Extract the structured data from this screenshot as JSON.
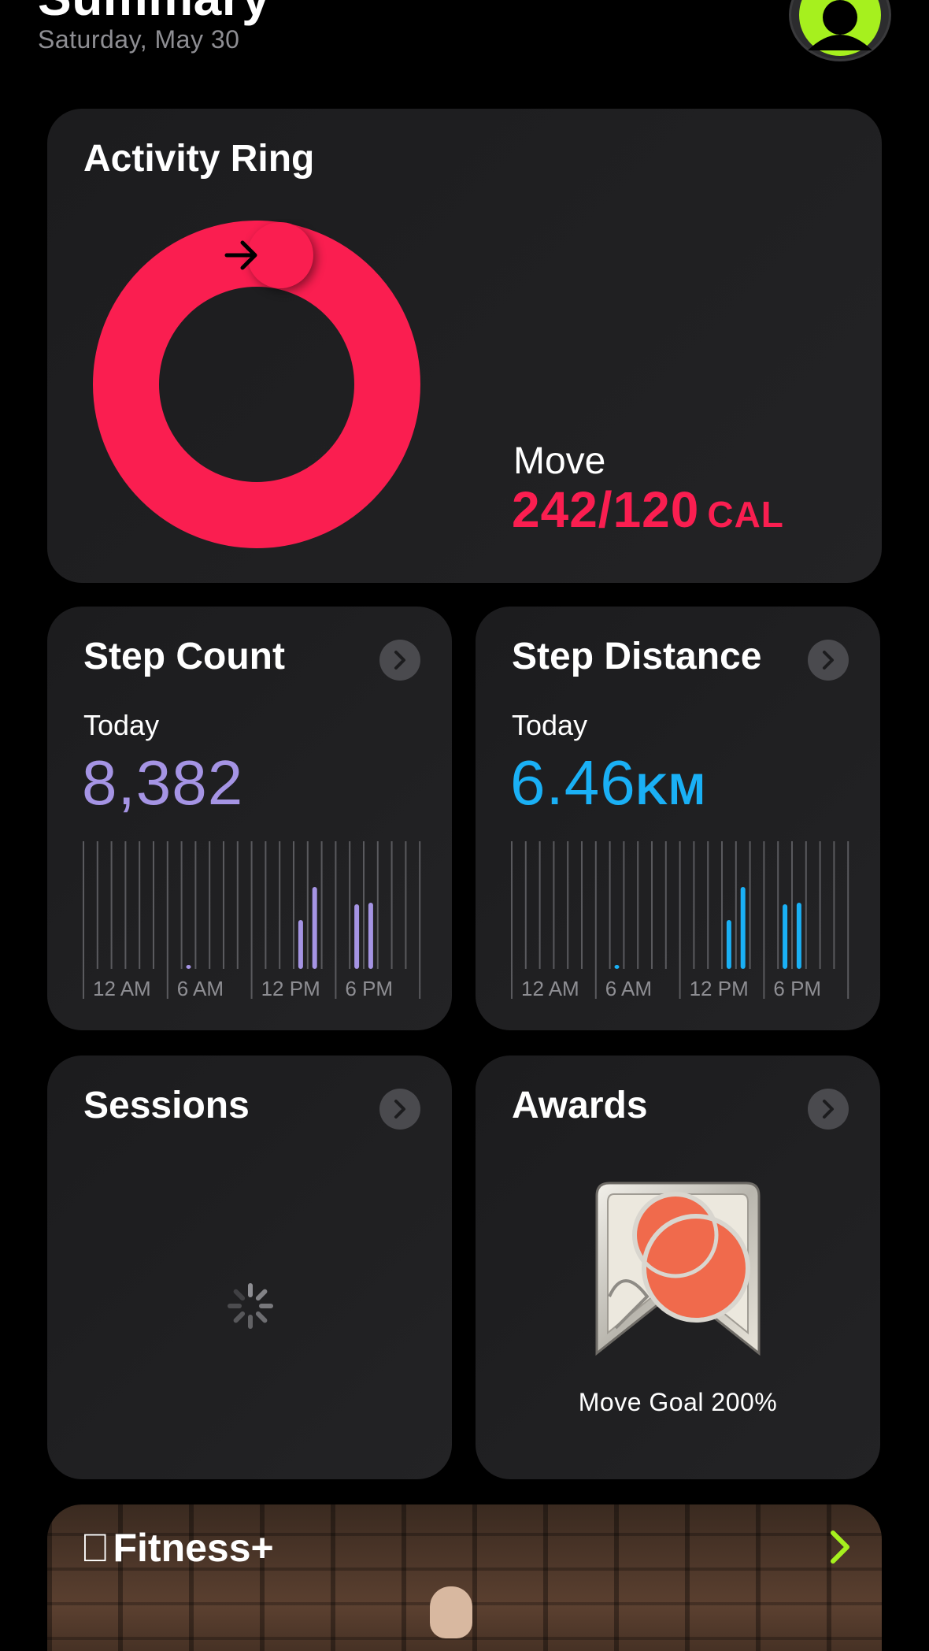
{
  "header": {
    "title": "Summary",
    "date": "Saturday, May 30"
  },
  "activity": {
    "title": "Activity Ring",
    "move_label": "Move",
    "move_value": "242/120",
    "move_unit": "CAL",
    "ring_color": "#fa1e50",
    "progress_fraction": 2.02
  },
  "step_count": {
    "title": "Step Count",
    "period": "Today",
    "value": "8,382",
    "color": "#a594e4",
    "axis_labels": [
      "12 AM",
      "6 AM",
      "12 PM",
      "6 PM"
    ]
  },
  "step_distance": {
    "title": "Step Distance",
    "period": "Today",
    "value": "6.46",
    "unit": "KM",
    "color": "#1ab0f5",
    "axis_labels": [
      "12 AM",
      "6 AM",
      "12 PM",
      "6 PM"
    ]
  },
  "sessions": {
    "title": "Sessions"
  },
  "awards": {
    "title": "Awards",
    "award_name": "Move Goal 200%"
  },
  "fitness": {
    "brand": "Fitness+",
    "accent": "#a6f01e"
  },
  "icons": {
    "avatar": "person-icon",
    "chevron": "chevron-right-icon",
    "arrow": "arrow-right-icon",
    "spinner": "spinner-icon",
    "apple": "apple-logo-icon"
  }
}
